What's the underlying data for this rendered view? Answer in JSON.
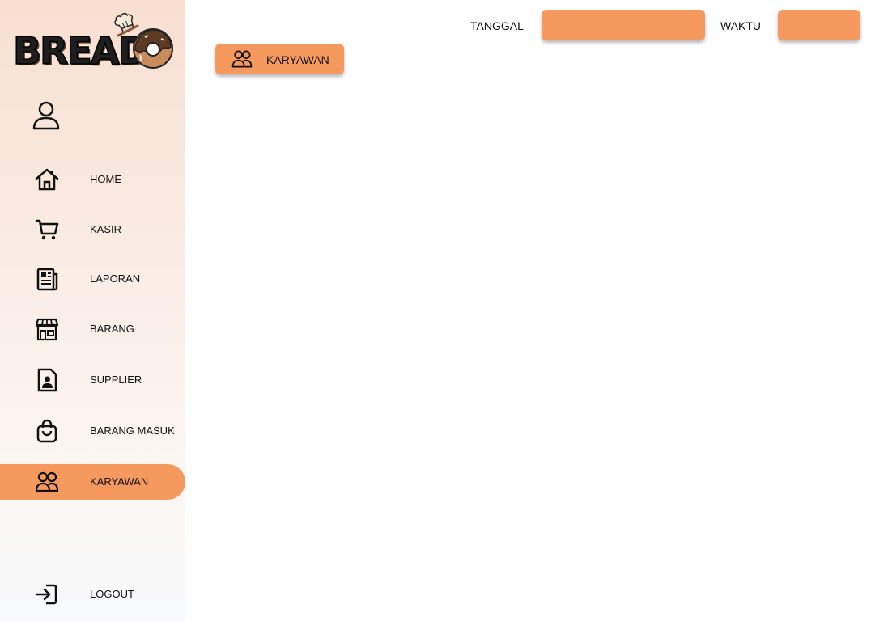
{
  "brand": {
    "logo_text": "BREAD"
  },
  "topbar": {
    "date_label": "TANGGAL",
    "date_value": "",
    "time_label": "WAKTU",
    "time_value": ""
  },
  "page": {
    "title": "KARYAWAN",
    "icon": "users-icon"
  },
  "sidebar": {
    "items": [
      {
        "label": "HOME",
        "icon": "home-icon"
      },
      {
        "label": "KASIR",
        "icon": "cart-icon"
      },
      {
        "label": "LAPORAN",
        "icon": "newspaper-icon"
      },
      {
        "label": "BARANG",
        "icon": "store-icon"
      },
      {
        "label": "SUPPLIER",
        "icon": "contact-file-icon"
      },
      {
        "label": "BARANG MASUK",
        "icon": "shopping-bag-icon"
      },
      {
        "label": "KARYAWAN",
        "icon": "users-icon",
        "active": true
      }
    ],
    "logout_label": "LOGOUT"
  },
  "colors": {
    "accent": "#f6995f",
    "sidebar_top": "#f8dfd0",
    "sidebar_bottom": "#f8f9fb"
  }
}
